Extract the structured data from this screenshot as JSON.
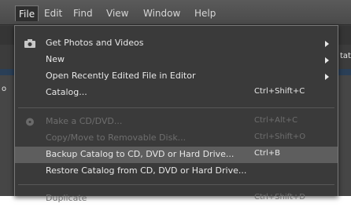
{
  "menubar": {
    "items": [
      {
        "label": "File"
      },
      {
        "label": "Edit"
      },
      {
        "label": "Find"
      },
      {
        "label": "View"
      },
      {
        "label": "Window"
      },
      {
        "label": "Help"
      }
    ]
  },
  "background": {
    "peek_right": "tat",
    "peek_left": "o"
  },
  "file_menu": {
    "items": [
      {
        "label": "Get Photos and Videos",
        "shortcut": "",
        "submenu": true,
        "state": "enabled",
        "icon": "camera-icon"
      },
      {
        "label": "New",
        "shortcut": "",
        "submenu": true,
        "state": "enabled"
      },
      {
        "label": "Open Recently Edited File in Editor",
        "shortcut": "",
        "submenu": true,
        "state": "enabled"
      },
      {
        "label": "Catalog...",
        "shortcut": "Ctrl+Shift+C",
        "submenu": false,
        "state": "enabled"
      },
      {
        "label": "Make a CD/DVD...",
        "shortcut": "Ctrl+Alt+C",
        "submenu": false,
        "state": "disabled",
        "icon": "disc-icon"
      },
      {
        "label": "Copy/Move to Removable Disk...",
        "shortcut": "Ctrl+Shift+O",
        "submenu": false,
        "state": "disabled"
      },
      {
        "label": "Backup Catalog to CD, DVD or Hard Drive...",
        "shortcut": "Ctrl+B",
        "submenu": false,
        "state": "hover"
      },
      {
        "label": "Restore Catalog from CD, DVD or Hard Drive...",
        "shortcut": "",
        "submenu": false,
        "state": "enabled"
      },
      {
        "label": "Duplicate",
        "shortcut": "Ctrl+Shift+D",
        "submenu": false,
        "state": "disabled"
      }
    ]
  }
}
